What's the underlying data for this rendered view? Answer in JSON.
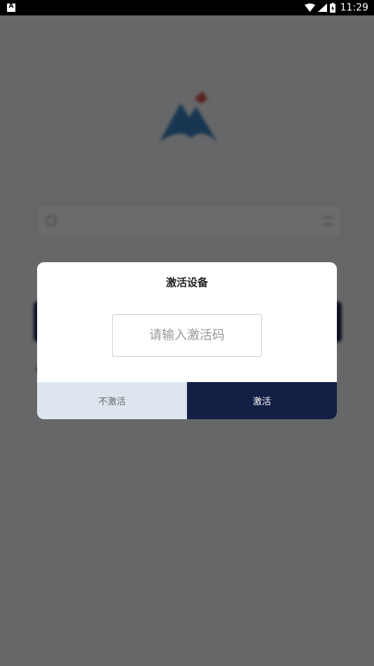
{
  "status_bar": {
    "notification_icon": "android-notification-icon",
    "wifi_icon": "wifi-icon",
    "signal_icon": "cellular-signal-icon",
    "battery_icon": "battery-charging-icon",
    "time": "11:29"
  },
  "background": {
    "logo_icon": "app-logo-icon"
  },
  "dialog": {
    "title": "激活设备",
    "input": {
      "value": "",
      "placeholder": "请输入激活码"
    },
    "cancel_label": "不激活",
    "confirm_label": "激活"
  },
  "colors": {
    "confirm_button": "#131f45",
    "cancel_button": "#dde6ef",
    "overlay": "rgba(0,0,0,0.58)"
  }
}
